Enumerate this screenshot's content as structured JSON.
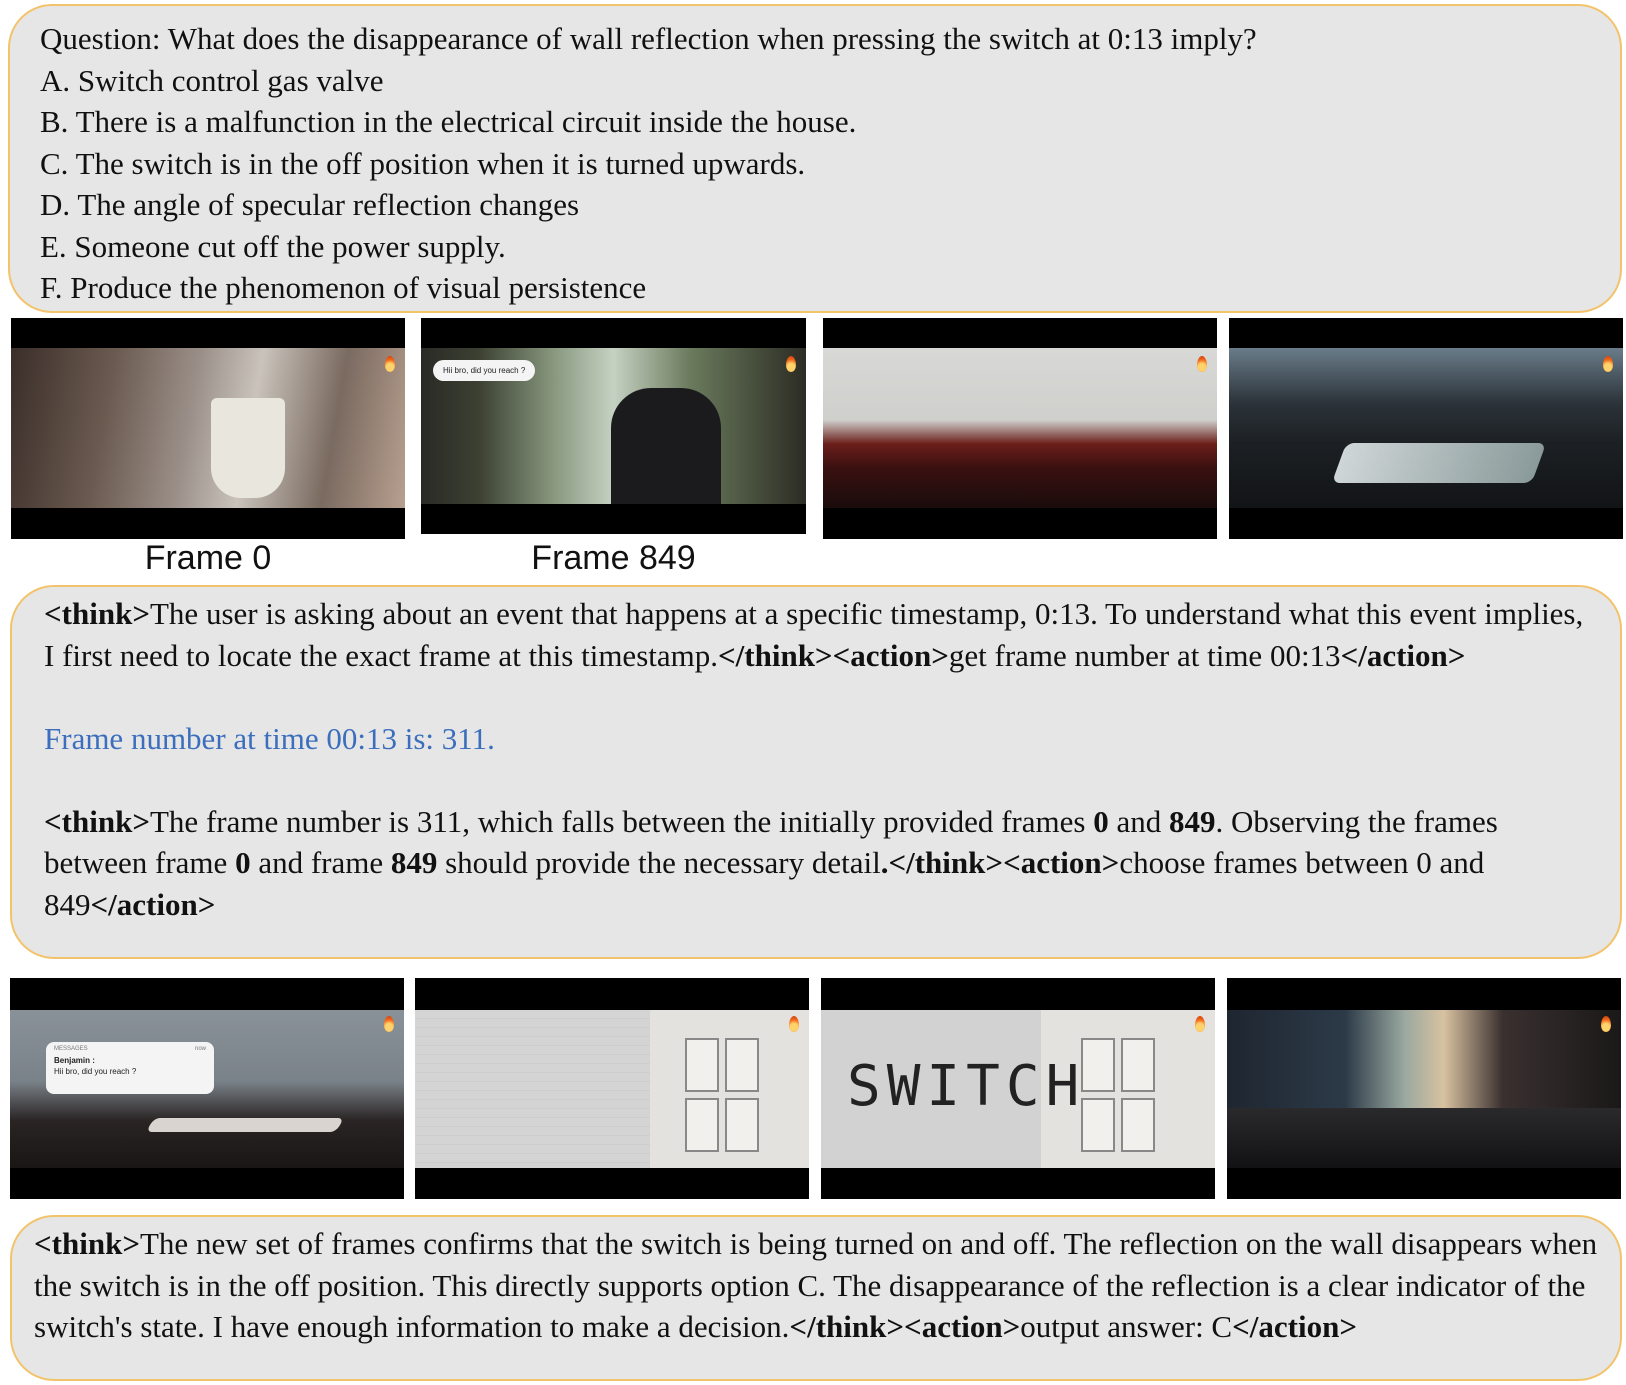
{
  "question": {
    "lines": [
      "Question: What does the disappearance of wall reflection when pressing the switch at 0:13 imply?",
      "A. Switch control gas valve",
      "B. There is a malfunction in the electrical circuit inside the house.",
      "C. The switch is in the off position when it is turned upwards.",
      "D. The angle of specular reflection changes",
      "E. Someone cut off the power supply.",
      "F. Produce the phenomenon of visual persistence"
    ]
  },
  "frames_row1": {
    "labels": [
      "Frame 0",
      "Frame 849"
    ],
    "message_bubble": "Hii bro, did you reach ?"
  },
  "step1": {
    "think_open": "<think>",
    "think_text": "The user is asking about an event that happens at a specific timestamp, 0:13. To understand what this event implies, I first need to locate the exact frame at this timestamp.",
    "think_close": "</think>",
    "action_open": "<action>",
    "action_text": "get frame number at time 00:13",
    "action_close": "</action>",
    "observation": "Frame number at time 00:13 is: 311."
  },
  "step2": {
    "think_open": "<think>",
    "text_a": "The frame number is 311, which falls between the initially provided frames ",
    "bold_a": "0",
    "text_b": " and ",
    "bold_b": "849",
    "text_c": ". Observing the frames between frame ",
    "bold_c": "0",
    "text_d": " and frame ",
    "bold_d": "849",
    "text_e": " should provide the necessary detail",
    "bold_period": ".",
    "think_close": "</think>",
    "action_open": "<action>",
    "action_text": "choose frames between 0 and 849",
    "action_close": "</action>"
  },
  "frames_row2": {
    "notification_app": "MESSAGES",
    "notification_time": "now",
    "notification_sender": "Benjamin :",
    "notification_text": "Hii bro, did you reach ?",
    "switch_word": "SWITCH"
  },
  "step3": {
    "think_open": "<think>",
    "think_text": "The new set of frames confirms that the switch is being turned on and off. The reflection on the wall disappears when the switch is in the off position. This directly supports option C. The disappearance of the reflection is a clear indicator of the switch's state. I have enough information to make a decision.",
    "think_close": "</think>",
    "action_open": "<action>",
    "action_text": "output answer: C",
    "action_close": "</action>"
  }
}
